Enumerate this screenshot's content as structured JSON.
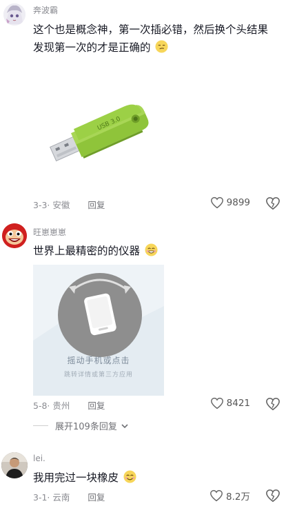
{
  "comments": [
    {
      "username": "奔波霸",
      "text": "这个也是概念神，第一次插必错，然后换个头结果发现第一次的才是正确的",
      "emoji": "smirk-emoji",
      "date": "3-3",
      "location": "安徽",
      "reply_label": "回复",
      "likes": "9899",
      "image": {
        "type": "usb-drive",
        "usb_label": "USB 3.0"
      }
    },
    {
      "username": "旺崽崽崽",
      "text": "世界上最精密的的仪器",
      "emoji": "grin-emoji",
      "date": "5-8",
      "location": "贵州",
      "reply_label": "回复",
      "likes": "8421",
      "card": {
        "line1": "摇动手机或点击",
        "line2": "跳转详情或第三方应用"
      },
      "expand_label": "展开109条回复"
    },
    {
      "username": "lei.",
      "text": "我用完过一块橡皮",
      "emoji": "smile-emoji",
      "date": "3-1",
      "location": "云南",
      "reply_label": "回复",
      "likes": "8.2万"
    }
  ],
  "colors": {
    "usb_green": "#8fc43a",
    "meta_gray": "#8a8b91",
    "card_bg": "#eef3f7"
  }
}
